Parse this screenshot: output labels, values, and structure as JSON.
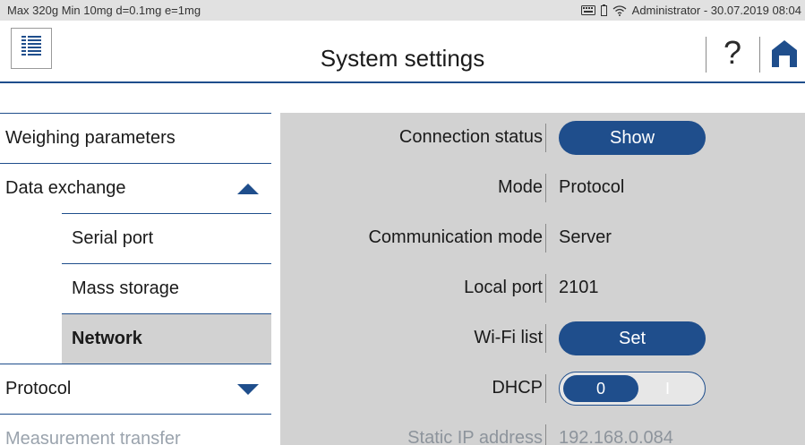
{
  "statusbar": {
    "specs": "Max 320g  Min 10mg  d=0.1mg  e=1mg",
    "user_datetime": "Administrator - 30.07.2019 08:04",
    "icons": [
      "keyboard-icon",
      "battery-icon",
      "wifi-icon"
    ]
  },
  "header": {
    "title": "System settings",
    "help_label": "?",
    "icons": [
      "menu-list-icon",
      "help-icon",
      "home-icon"
    ]
  },
  "nav": {
    "items": [
      {
        "label": "Weighing parameters"
      },
      {
        "label": "Data exchange",
        "expanded": true
      },
      {
        "label": "Serial port"
      },
      {
        "label": "Mass storage"
      },
      {
        "label": "Network",
        "active": true
      },
      {
        "label": "Protocol",
        "expanded": false
      },
      {
        "label": "Measurement transfer"
      }
    ]
  },
  "settings": {
    "rows": [
      {
        "label": "Connection status",
        "button": "Show"
      },
      {
        "label": "Mode",
        "value": "Protocol"
      },
      {
        "label": "Communication mode",
        "value": "Server"
      },
      {
        "label": "Local port",
        "value": "2101"
      },
      {
        "label": "Wi-Fi list",
        "button": "Set"
      },
      {
        "label": "DHCP",
        "toggle_off": "0",
        "toggle_on": "I",
        "state": "off"
      },
      {
        "label": "Static IP address",
        "value": "192.168.0.084"
      }
    ]
  },
  "colors": {
    "accent": "#1f4e8c",
    "panel": "#d2d2d2",
    "statusbar": "#e1e1e1"
  }
}
